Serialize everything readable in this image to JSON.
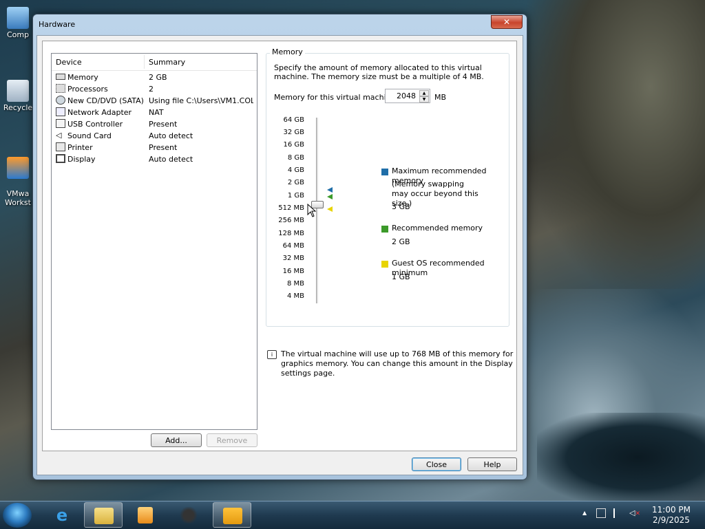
{
  "desktop": {
    "icons": [
      {
        "label": "Comp"
      },
      {
        "label": "Recycle"
      },
      {
        "label": "VMwa\nWorkst"
      }
    ]
  },
  "window": {
    "title": "Hardware",
    "close_glyph": "✕"
  },
  "device_list": {
    "header_device": "Device",
    "header_summary": "Summary",
    "rows": [
      {
        "name": "Memory",
        "summary": "2 GB",
        "icon": "memory-icon"
      },
      {
        "name": "Processors",
        "summary": "2",
        "icon": "processor-icon"
      },
      {
        "name": "New CD/DVD (SATA)",
        "summary": "Using file C:\\Users\\VM1.COL...",
        "icon": "cd-dvd-icon"
      },
      {
        "name": "Network Adapter",
        "summary": "NAT",
        "icon": "network-adapter-icon"
      },
      {
        "name": "USB Controller",
        "summary": "Present",
        "icon": "usb-icon"
      },
      {
        "name": "Sound Card",
        "summary": "Auto detect",
        "icon": "sound-icon"
      },
      {
        "name": "Printer",
        "summary": "Present",
        "icon": "printer-icon"
      },
      {
        "name": "Display",
        "summary": "Auto detect",
        "icon": "display-icon"
      }
    ],
    "add_label": "Add...",
    "remove_label": "Remove"
  },
  "memory": {
    "group_title": "Memory",
    "description": "Specify the amount of memory allocated to this virtual machine. The memory size must be a multiple of 4 MB.",
    "field_label": "Memory for this virtual machine:",
    "value": "2048",
    "unit": "MB",
    "scale_labels": [
      "64 GB",
      "32 GB",
      "16 GB",
      "8 GB",
      "4 GB",
      "2 GB",
      "1 GB",
      "512 MB",
      "256 MB",
      "128 MB",
      "64 MB",
      "32 MB",
      "16 MB",
      "8 MB",
      "4 MB"
    ],
    "legend": {
      "max_title": "Maximum recommended memory",
      "max_note": "(Memory swapping may occur beyond this size.)",
      "max_value": "3 GB",
      "rec_title": "Recommended memory",
      "rec_value": "2 GB",
      "min_title": "Guest OS recommended minimum",
      "min_value": "1 GB"
    },
    "colors": {
      "max": "#1f6ea8",
      "rec": "#3c9a2a",
      "min": "#e8d400"
    },
    "info_text": "The virtual machine will use up to 768 MB of this memory for graphics memory. You can change this amount in the Display settings page."
  },
  "footer": {
    "close_label": "Close",
    "help_label": "Help"
  },
  "taskbar": {
    "clock_time": "11:00 PM",
    "clock_date": "2/9/2025"
  }
}
